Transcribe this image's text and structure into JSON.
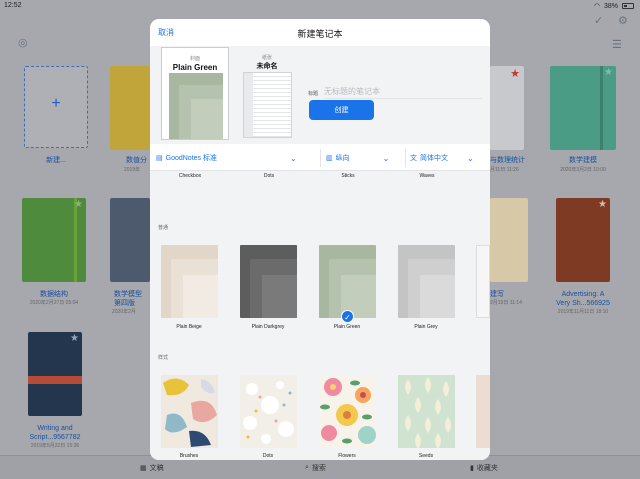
{
  "status_bar": {
    "time": "12:52",
    "battery": "38%"
  },
  "library": {
    "new_label": "新建...",
    "tiles": [
      {
        "label": "数值分",
        "date": "2019年"
      },
      {
        "label": "与数理统计",
        "date": "月11日 11:26"
      },
      {
        "label": "数学建模",
        "date": "2020年3月2日 10:00"
      },
      {
        "label": "数据结构",
        "date": "2020年2月27日 05:04"
      },
      {
        "label": "数学模型",
        "label2": "第四版",
        "date": "2020年2月"
      },
      {
        "label": "建写",
        "date": "2月19日 11:14"
      },
      {
        "label": "Advertising: A",
        "label2": "Very Sh...566925",
        "date": "2019年11月11日 18:10"
      },
      {
        "label": "Writing and",
        "label2": "Script...9567782",
        "date": "2019年5月22日 15:36"
      }
    ]
  },
  "tabbar": {
    "docs": "文稿",
    "search": "搜索",
    "favorites": "收藏夹"
  },
  "modal": {
    "cancel": "取消",
    "title": "新建笔记本",
    "cover_caption": "封面",
    "cover_name": "Plain Green",
    "paper_caption": "纸张",
    "paper_name": "未命名",
    "title_label": "标题",
    "title_placeholder": "无标题的笔记本",
    "create": "创建",
    "toolbar": {
      "template_set": "GoodNotes 标准",
      "orientation": "纵向",
      "language": "简体中文"
    },
    "top_row": [
      "Checkbox",
      "Dots",
      "Sticks",
      "Waves"
    ],
    "section_plain": "普通",
    "plain_covers": [
      {
        "name": "Plain Beige",
        "c1": "#e2d6c8",
        "c2": "#eae1d6",
        "c3": "#f1ebe3"
      },
      {
        "name": "Plain Darkgrey",
        "c1": "#5d5d5d",
        "c2": "#6b6b6b",
        "c3": "#7a7a7a"
      },
      {
        "name": "Plain Green",
        "c1": "#a8b7a0",
        "c2": "#b5c2ae",
        "c3": "#c2cdbc"
      },
      {
        "name": "Plain Grey",
        "c1": "#c4c4c4",
        "c2": "#cfcfcf",
        "c3": "#dadada"
      }
    ],
    "selected_index": 2,
    "section_styles": "样式",
    "style_covers": [
      "Brushes",
      "Dots",
      "Flowers",
      "Seeds"
    ]
  }
}
